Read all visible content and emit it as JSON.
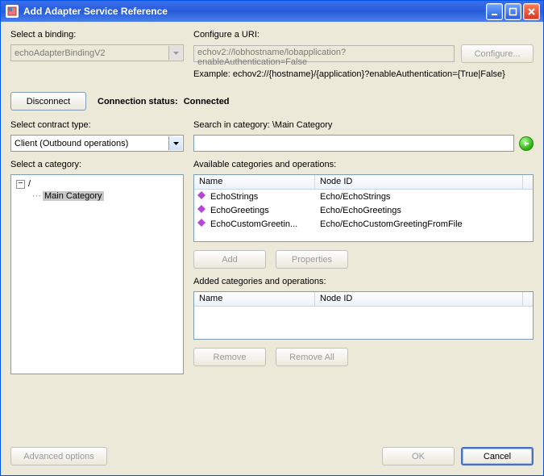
{
  "window": {
    "title": "Add Adapter Service Reference"
  },
  "binding": {
    "label": "Select a binding:",
    "value": "echoAdapterBindingV2"
  },
  "uri": {
    "label": "Configure a URI:",
    "value": "echov2://lobhostname/lobapplication?enableAuthentication=False",
    "configure_button": "Configure...",
    "example": "Example: echov2://{hostname}/{application}?enableAuthentication={True|False}"
  },
  "connection": {
    "disconnect_button": "Disconnect",
    "status_label": "Connection status:",
    "status_value": "Connected"
  },
  "contract": {
    "label": "Select contract type:",
    "value": "Client (Outbound operations)"
  },
  "search": {
    "label_prefix": "Search in category: ",
    "category": "\\Main Category",
    "value": ""
  },
  "category_tree": {
    "label": "Select a category:",
    "root": "/",
    "selected": "Main Category"
  },
  "available": {
    "label": "Available categories and operations:",
    "columns": {
      "name": "Name",
      "node": "Node ID"
    },
    "rows": [
      {
        "name": "EchoStrings",
        "node": "Echo/EchoStrings"
      },
      {
        "name": "EchoGreetings",
        "node": "Echo/EchoGreetings"
      },
      {
        "name": "EchoCustomGreetin...",
        "node": "Echo/EchoCustomGreetingFromFile"
      }
    ],
    "add_button": "Add",
    "props_button": "Properties"
  },
  "added": {
    "label": "Added categories and operations:",
    "columns": {
      "name": "Name",
      "node": "Node ID"
    },
    "rows": [],
    "remove_button": "Remove",
    "remove_all_button": "Remove All"
  },
  "footer": {
    "advanced_button": "Advanced options",
    "ok_button": "OK",
    "cancel_button": "Cancel"
  }
}
